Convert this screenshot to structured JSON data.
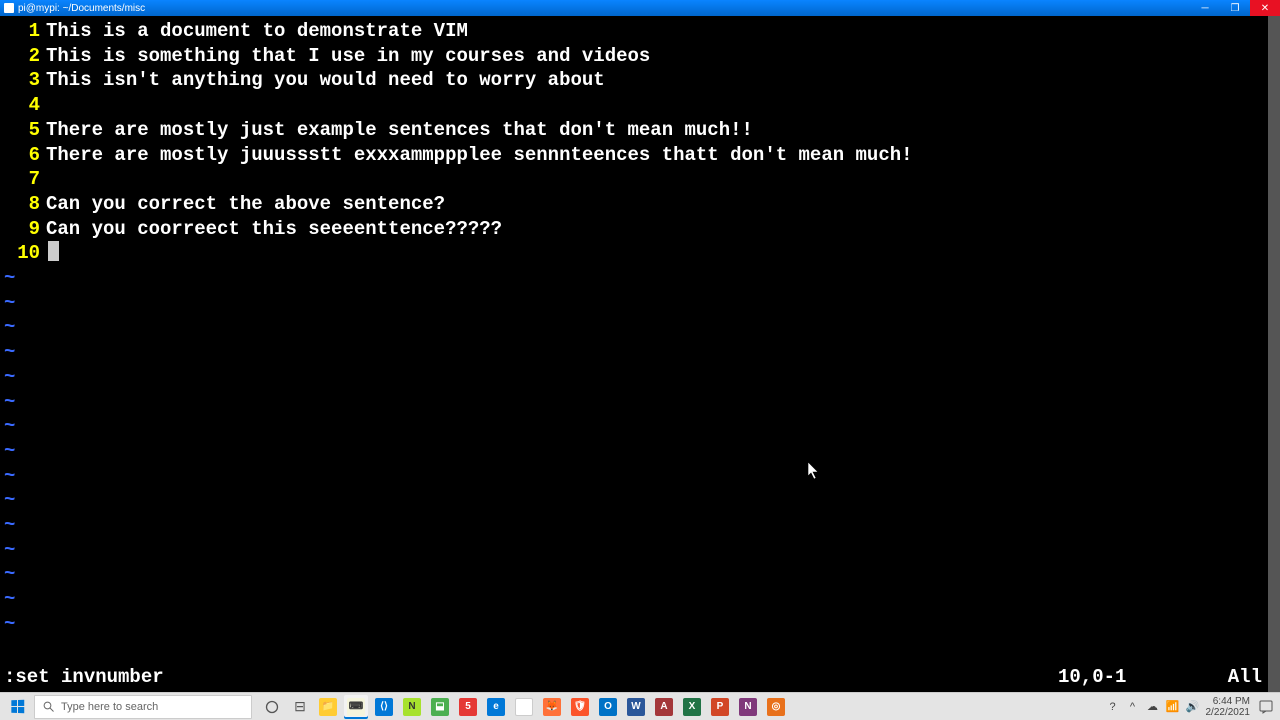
{
  "window": {
    "title": "pi@mypi: ~/Documents/misc"
  },
  "editor": {
    "lines": [
      {
        "n": "1",
        "t": "This is a document to demonstrate VIM"
      },
      {
        "n": "2",
        "t": "This is something that I use in my courses and videos"
      },
      {
        "n": "3",
        "t": "This isn't anything you would need to worry about"
      },
      {
        "n": "4",
        "t": ""
      },
      {
        "n": "5",
        "t": "There are mostly just example sentences that don't mean much!!"
      },
      {
        "n": "6",
        "t": "There are mostly juuussstt exxxammppplee sennnteences thatt don't mean much!"
      },
      {
        "n": "7",
        "t": ""
      },
      {
        "n": "8",
        "t": "Can you correct the above sentence?"
      },
      {
        "n": "9",
        "t": "Can you coorreect this seeeenttence?????"
      },
      {
        "n": "10",
        "t": ""
      }
    ],
    "tilde_count": 15,
    "command": ":set invnumber",
    "position": "10,0-1",
    "percent": "All",
    "cursor_line_index": 9
  },
  "taskbar": {
    "search_placeholder": "Type here to search",
    "time": "6:44 PM",
    "date": "2/22/2021"
  }
}
